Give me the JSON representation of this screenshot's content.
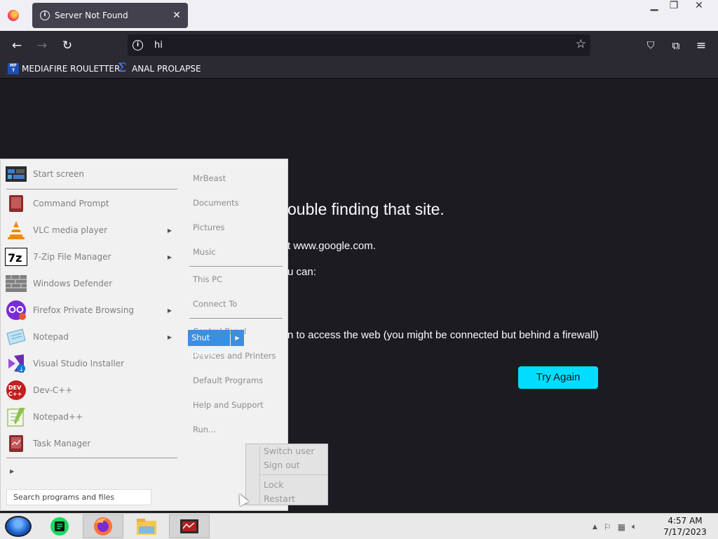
{
  "browser": {
    "tab_title": "Server Not Found",
    "url": "hi",
    "bookmarks": [
      {
        "label": "MEDIAFIRE ROULETTER",
        "icon": "mediafire-icon"
      },
      {
        "label": "ANAL PROLAPSE",
        "icon": "sigma-icon"
      }
    ]
  },
  "page": {
    "heading": "ouble finding that site.",
    "line1": "t www.google.com.",
    "line2": "u can:",
    "line3": "n to access the web (you might be connected but behind a firewall)",
    "try_again": "Try Again"
  },
  "start_menu": {
    "programs": [
      {
        "label": "Start screen",
        "icon": "start-screen-icon",
        "arrow": false
      },
      {
        "label": "Command Prompt",
        "icon": "command-prompt-icon",
        "arrow": false
      },
      {
        "label": "VLC media player",
        "icon": "vlc-icon",
        "arrow": true
      },
      {
        "label": "7-Zip File Manager",
        "icon": "7zip-icon",
        "arrow": true
      },
      {
        "label": "Windows Defender",
        "icon": "windows-defender-icon",
        "arrow": false
      },
      {
        "label": "Firefox Private Browsing",
        "icon": "firefox-private-icon",
        "arrow": true
      },
      {
        "label": "Notepad",
        "icon": "notepad-icon",
        "arrow": true
      },
      {
        "label": "Visual Studio Installer",
        "icon": "visual-studio-installer-icon",
        "arrow": false
      },
      {
        "label": "Dev-C++",
        "icon": "devcpp-icon",
        "arrow": false
      },
      {
        "label": "Notepad++",
        "icon": "notepadpp-icon",
        "arrow": false
      },
      {
        "label": "Task Manager",
        "icon": "task-manager-icon",
        "arrow": false
      }
    ],
    "search_placeholder": "Search programs and files",
    "right_items": [
      "MrBeast",
      "Documents",
      "Pictures",
      "Music",
      "This PC",
      "Connect To",
      "Control Panel",
      "Devices and Printers",
      "Default Programs",
      "Help and Support",
      "Run..."
    ],
    "shutdown_label": "Shut down",
    "shutdown_submenu": [
      "Switch user",
      "Sign out",
      "Lock",
      "Restart"
    ]
  },
  "taskbar": {
    "apps": [
      "start-orb",
      "spotify-icon",
      "firefox-icon",
      "file-explorer-icon",
      "task-manager-icon"
    ],
    "time": "4:57 AM",
    "date": "7/17/2023"
  },
  "colors": {
    "accent": "#00ddff",
    "shutdown": "#3b8fe0",
    "page_bg": "#1c1b22"
  }
}
